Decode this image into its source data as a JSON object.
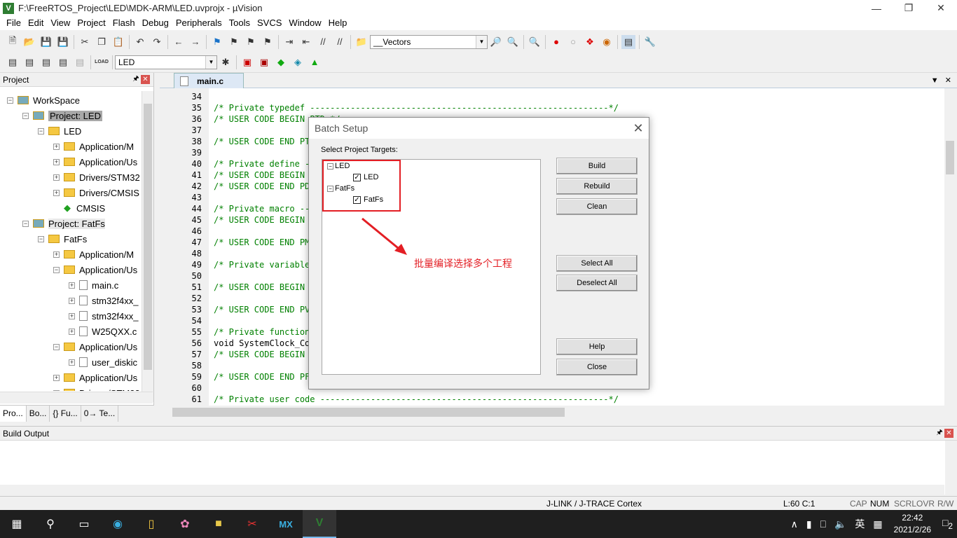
{
  "window": {
    "title": "F:\\FreeRTOS_Project\\LED\\MDK-ARM\\LED.uvprojx - µVision",
    "app_icon": "V"
  },
  "menu": [
    "File",
    "Edit",
    "View",
    "Project",
    "Flash",
    "Debug",
    "Peripherals",
    "Tools",
    "SVCS",
    "Window",
    "Help"
  ],
  "toolbar": {
    "find_combo_value": "__Vectors",
    "target_combo_value": "LED",
    "load_label": "LOAD"
  },
  "project_panel": {
    "title": "Project",
    "tree": [
      {
        "label": "WorkSpace",
        "indent": 0,
        "kind": "workspace",
        "exp": "-"
      },
      {
        "label": "Project: LED",
        "indent": 1,
        "kind": "project",
        "exp": "-",
        "selected": true
      },
      {
        "label": "LED",
        "indent": 2,
        "kind": "target",
        "exp": "-"
      },
      {
        "label": "Application/M",
        "indent": 3,
        "kind": "folder",
        "exp": "+"
      },
      {
        "label": "Application/Us",
        "indent": 3,
        "kind": "folder",
        "exp": "+"
      },
      {
        "label": "Drivers/STM32",
        "indent": 3,
        "kind": "folder",
        "exp": "+"
      },
      {
        "label": "Drivers/CMSIS",
        "indent": 3,
        "kind": "folder",
        "exp": "+"
      },
      {
        "label": "CMSIS",
        "indent": 3,
        "kind": "cmsis",
        "exp": ""
      },
      {
        "label": "Project: FatFs",
        "indent": 1,
        "kind": "project",
        "exp": "-"
      },
      {
        "label": "FatFs",
        "indent": 2,
        "kind": "target",
        "exp": "-"
      },
      {
        "label": "Application/M",
        "indent": 3,
        "kind": "folder",
        "exp": "+"
      },
      {
        "label": "Application/Us",
        "indent": 3,
        "kind": "folder",
        "exp": "-"
      },
      {
        "label": "main.c",
        "indent": 4,
        "kind": "file",
        "exp": "+"
      },
      {
        "label": "stm32f4xx_",
        "indent": 4,
        "kind": "file",
        "exp": "+"
      },
      {
        "label": "stm32f4xx_",
        "indent": 4,
        "kind": "file",
        "exp": "+"
      },
      {
        "label": "W25QXX.c",
        "indent": 4,
        "kind": "file",
        "exp": "+"
      },
      {
        "label": "Application/Us",
        "indent": 3,
        "kind": "folder",
        "exp": "-"
      },
      {
        "label": "user_diskic",
        "indent": 4,
        "kind": "file",
        "exp": "+"
      },
      {
        "label": "Application/Us",
        "indent": 3,
        "kind": "folder",
        "exp": "+"
      },
      {
        "label": "Drivers/STM32",
        "indent": 3,
        "kind": "folder",
        "exp": "+"
      }
    ],
    "tabs": [
      "Pro...",
      "Bo...",
      "{} Fu...",
      "0→ Te..."
    ]
  },
  "editor": {
    "tab": "main.c",
    "lines": [
      {
        "n": "34",
        "t": ""
      },
      {
        "n": "35",
        "t": "/* Private typedef -----------------------------------------------------------*/"
      },
      {
        "n": "36",
        "t": "/* USER CODE BEGIN PTD */"
      },
      {
        "n": "37",
        "t": ""
      },
      {
        "n": "38",
        "t": "/* USER CODE END PTD */"
      },
      {
        "n": "39",
        "t": ""
      },
      {
        "n": "40",
        "t": "/* Private define ------------------------------------------------------------*/"
      },
      {
        "n": "41",
        "t": "/* USER CODE BEGIN PD */"
      },
      {
        "n": "42",
        "t": "/* USER CODE END PD */"
      },
      {
        "n": "43",
        "t": ""
      },
      {
        "n": "44",
        "t": "/* Private macro -------------------------------------------------------------*/"
      },
      {
        "n": "45",
        "t": "/* USER CODE BEGIN PM */"
      },
      {
        "n": "46",
        "t": ""
      },
      {
        "n": "47",
        "t": "/* USER CODE END PM */"
      },
      {
        "n": "48",
        "t": ""
      },
      {
        "n": "49",
        "t": "/* Private variables ---------------------------------------------------------*/"
      },
      {
        "n": "50",
        "t": ""
      },
      {
        "n": "51",
        "t": "/* USER CODE BEGIN PV */"
      },
      {
        "n": "52",
        "t": ""
      },
      {
        "n": "53",
        "t": "/* USER CODE END PV */"
      },
      {
        "n": "54",
        "t": ""
      },
      {
        "n": "55",
        "t": "/* Private function prototypes -----------------------------------------------*/"
      },
      {
        "n": "56",
        "t": "void SystemClock_Config(void);",
        "kw": true
      },
      {
        "n": "57",
        "t": "/* USER CODE BEGIN PFP */"
      },
      {
        "n": "58",
        "t": ""
      },
      {
        "n": "59",
        "t": "/* USER CODE END PFP */"
      },
      {
        "n": "60",
        "t": ""
      },
      {
        "n": "61",
        "t": "/* Private user code ---------------------------------------------------------*/"
      }
    ]
  },
  "dialog": {
    "title": "Batch Setup",
    "label": "Select Project Targets:",
    "targets": [
      {
        "project": "LED",
        "target": "LED",
        "checked": true
      },
      {
        "project": "FatFs",
        "target": "FatFs",
        "checked": true
      }
    ],
    "annotation": "批量编译选择多个工程",
    "buttons": {
      "build": "Build",
      "rebuild": "Rebuild",
      "clean": "Clean",
      "select_all": "Select All",
      "deselect_all": "Deselect All",
      "help": "Help",
      "close": "Close"
    },
    "highlight_color": "#e31e24"
  },
  "build_output": {
    "title": "Build Output"
  },
  "status": {
    "debugger": "J-LINK / J-TRACE Cortex",
    "position": "L:60 C:1",
    "cap": "CAP",
    "num": "NUM",
    "scrl": "SCRL",
    "ovr": "OVR",
    "rw": "R/W"
  },
  "taskbar": {
    "time": "22:42",
    "date": "2021/2/26",
    "ime": "英",
    "notification_count": "2"
  }
}
